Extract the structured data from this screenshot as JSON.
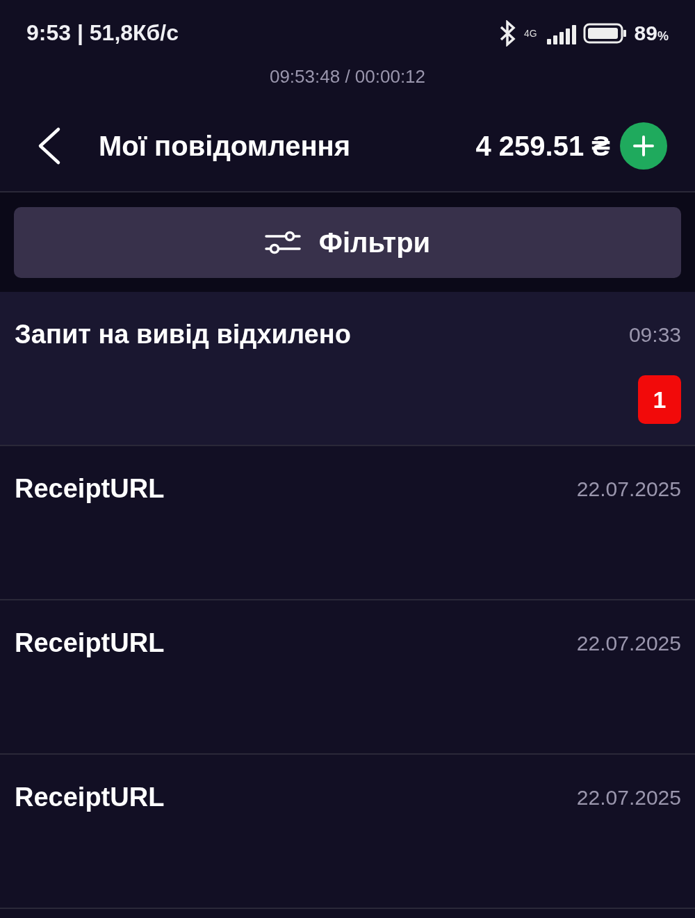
{
  "status_bar": {
    "time": "9:53 | 51,8Кб/с",
    "network": "4G",
    "battery": "89",
    "battery_unit": "%"
  },
  "recording_timer": "09:53:48 / 00:00:12",
  "header": {
    "title": "Мої повідомлення",
    "balance": "4 259.51 ₴"
  },
  "filter_button": {
    "label": "Фільтри"
  },
  "messages": [
    {
      "title": "Запит на вивід відхилено",
      "time": "09:33",
      "unread": true,
      "badge": "1"
    },
    {
      "title": "ReceiptURL",
      "time": "22.07.2025",
      "unread": false
    },
    {
      "title": "ReceiptURL",
      "time": "22.07.2025",
      "unread": false
    },
    {
      "title": "ReceiptURL",
      "time": "22.07.2025",
      "unread": false
    }
  ]
}
